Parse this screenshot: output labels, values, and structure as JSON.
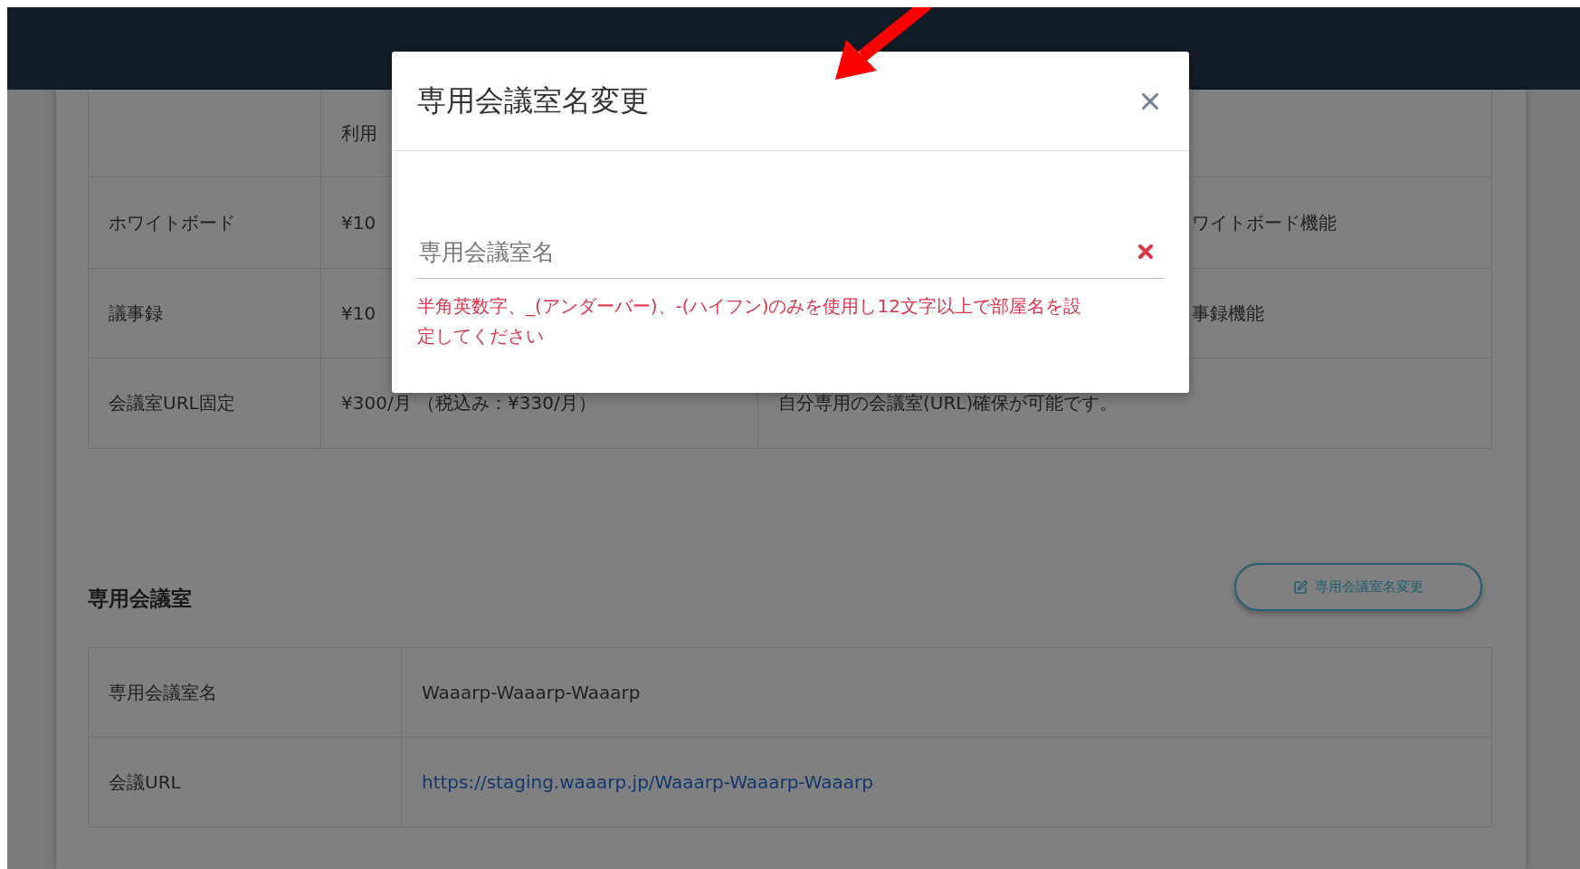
{
  "pricing_table": {
    "header": "利用",
    "rows": [
      {
        "name": "ホワイトボード",
        "price": "¥10",
        "description": "ワイトボード機能"
      },
      {
        "name": "議事録",
        "price": "¥10",
        "description": "事録機能"
      },
      {
        "name": "会議室URL固定",
        "price": "¥300/月 （税込み：¥330/月）",
        "description": "自分専用の会議室(URL)確保が可能です。"
      }
    ]
  },
  "modal": {
    "title": "専用会議室名変更",
    "field": {
      "placeholder": "専用会議室名",
      "invalid": true
    },
    "error": "半角英数字、_(アンダーバー)、-(ハイフン)のみを使用し12文字以上で部屋名を設定してください"
  },
  "room_section": {
    "title": "専用会議室",
    "button": "専用会議室名変更",
    "rows": [
      {
        "label": "専用会議室名",
        "value": "Waaarp-Waaarp-Waaarp",
        "kind": "text"
      },
      {
        "label": "会議URL",
        "value": "https://staging.waaarp.jp/Waaarp-Waaarp-Waaarp",
        "kind": "link"
      }
    ]
  }
}
